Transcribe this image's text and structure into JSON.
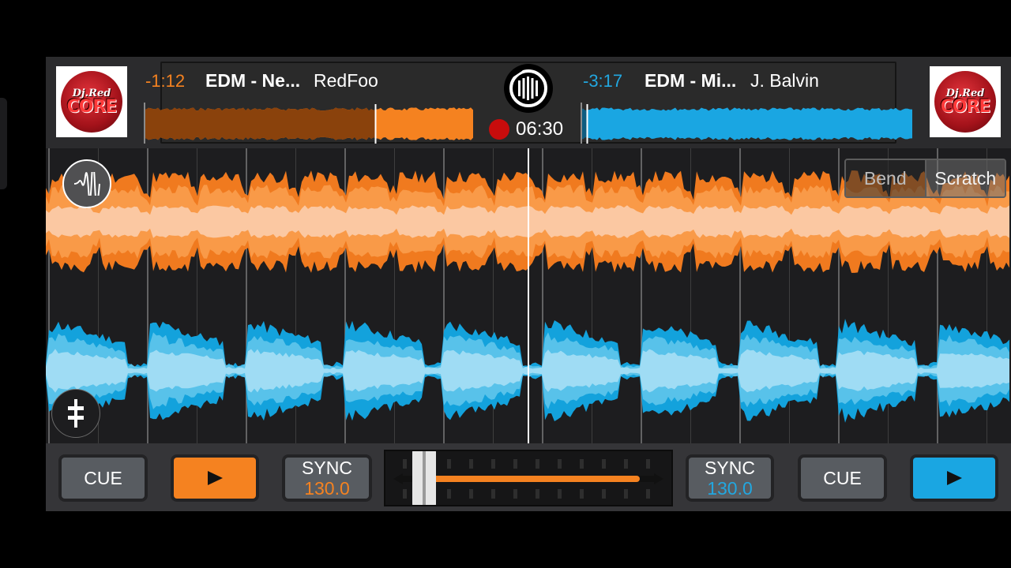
{
  "colors": {
    "deck_a": "#f58220",
    "deck_b": "#1aa6e2",
    "record": "#c80c0c"
  },
  "deck_a": {
    "logo_top": "Dj.Red",
    "logo_main": "CORE",
    "time_remaining": "-1:12",
    "title": "EDM - Ne...",
    "artist": "RedFoo",
    "cue_label": "CUE",
    "play_icon": "play-icon",
    "sync_label": "SYNC",
    "bpm": "130.0",
    "progress": 0.7
  },
  "deck_b": {
    "logo_top": "Dj.Red",
    "logo_main": "CORE",
    "time_remaining": "-3:17",
    "title": "EDM - Mi...",
    "artist": "J. Balvin",
    "cue_label": "CUE",
    "play_icon": "play-icon",
    "sync_label": "SYNC",
    "bpm": "130.0",
    "progress": 0.02
  },
  "recording": {
    "elapsed": "06:30",
    "icon": "record-icon"
  },
  "waveform_panel": {
    "modes": [
      "Bend",
      "Scratch"
    ],
    "selected_mode": "Scratch",
    "fx_icon": "waveform-icon",
    "eq_icon": "equalizer-icon"
  },
  "crossfader": {
    "position": 0.08
  }
}
